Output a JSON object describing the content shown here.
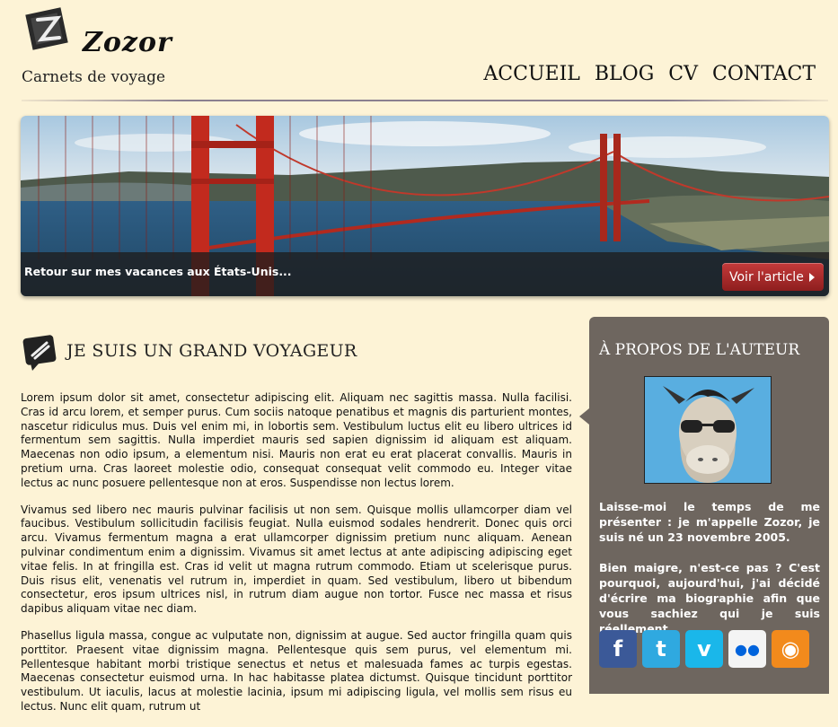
{
  "header": {
    "brand": "Zozor",
    "tagline": "Carnets de voyage",
    "nav": [
      "ACCUEIL",
      "BLOG",
      "CV",
      "CONTACT"
    ]
  },
  "banner": {
    "caption": "Retour sur mes vacances aux États-Unis...",
    "button_label": "Voir l'article"
  },
  "article": {
    "title": "JE SUIS UN GRAND VOYAGEUR",
    "paragraphs": [
      "Lorem ipsum dolor sit amet, consectetur adipiscing elit. Aliquam nec sagittis massa. Nulla facilisi. Cras id arcu lorem, et semper purus. Cum sociis natoque penatibus et magnis dis parturient montes, nascetur ridiculus mus. Duis vel enim mi, in lobortis sem. Vestibulum luctus elit eu libero ultrices id fermentum sem sagittis. Nulla imperdiet mauris sed sapien dignissim id aliquam est aliquam. Maecenas non odio ipsum, a elementum nisi. Mauris non erat eu erat placerat convallis. Mauris in pretium urna. Cras laoreet molestie odio, consequat consequat velit commodo eu. Integer vitae lectus ac nunc posuere pellentesque non at eros. Suspendisse non lectus lorem.",
      "Vivamus sed libero nec mauris pulvinar facilisis ut non sem. Quisque mollis ullamcorper diam vel faucibus. Vestibulum sollicitudin facilisis feugiat. Nulla euismod sodales hendrerit. Donec quis orci arcu. Vivamus fermentum magna a erat ullamcorper dignissim pretium nunc aliquam. Aenean pulvinar condimentum enim a dignissim. Vivamus sit amet lectus at ante adipiscing adipiscing eget vitae felis. In at fringilla est. Cras id velit ut magna rutrum commodo. Etiam ut scelerisque purus. Duis risus elit, venenatis vel rutrum in, imperdiet in quam. Sed vestibulum, libero ut bibendum consectetur, eros ipsum ultrices nisl, in rutrum diam augue non tortor. Fusce nec massa et risus dapibus aliquam vitae nec diam.",
      "Phasellus ligula massa, congue ac vulputate non, dignissim at augue. Sed auctor fringilla quam quis porttitor. Praesent vitae dignissim magna. Pellentesque quis sem purus, vel elementum mi. Pellentesque habitant morbi tristique senectus et netus et malesuada fames ac turpis egestas. Maecenas consectetur euismod urna. In hac habitasse platea dictumst. Quisque tincidunt porttitor vestibulum. Ut iaculis, lacus at molestie lacinia, ipsum mi adipiscing ligula, vel mollis sem risus eu lectus. Nunc elit quam, rutrum ut"
    ]
  },
  "sidebar": {
    "title": "À PROPOS DE L'AUTEUR",
    "paragraphs": [
      "Laisse-moi le temps de me présenter : je m'appelle Zozor, je suis né un 23 novembre 2005.",
      "Bien maigre, n'est-ce pas ? C'est pourquoi, aujourd'hui, j'ai décidé d'écrire ma biographie afin que vous sachiez qui je suis réellement."
    ],
    "socials": [
      {
        "name": "facebook",
        "glyph": "f",
        "color": "#3b5998"
      },
      {
        "name": "twitter",
        "glyph": "t",
        "color": "#2fa9e0"
      },
      {
        "name": "vimeo",
        "glyph": "v",
        "color": "#1ab7ea"
      },
      {
        "name": "flickr",
        "glyph": "●●",
        "color": "#f4f4f4"
      },
      {
        "name": "rss",
        "glyph": "◉",
        "color": "#f28a1c"
      }
    ]
  },
  "colors": {
    "background": "#fdf3d6",
    "sidebar": "#6e665f",
    "button": "#a82a2a"
  }
}
